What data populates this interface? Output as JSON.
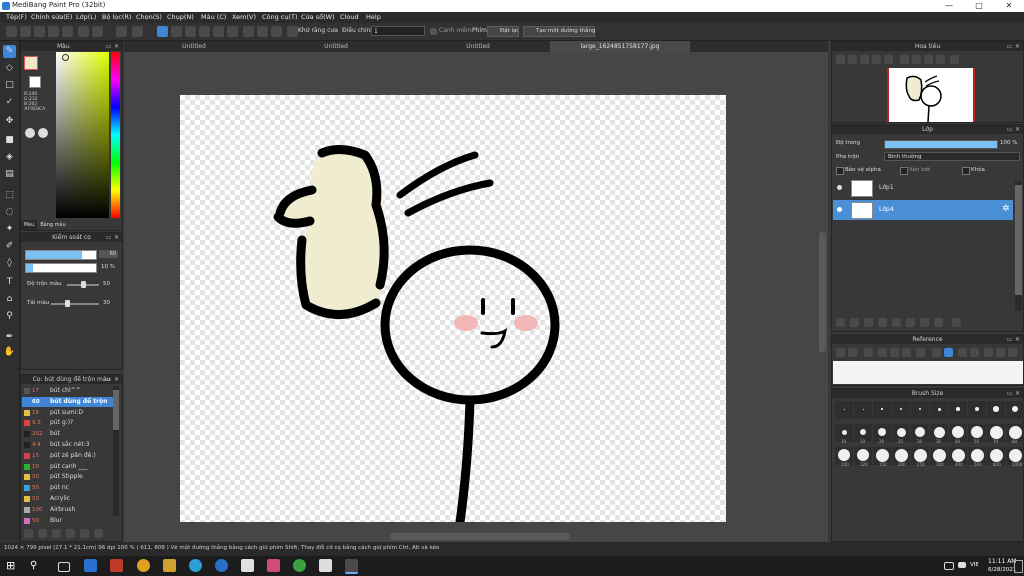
{
  "window": {
    "title": "MediBang Paint Pro (32bit)",
    "minimize": "—",
    "maximize": "□",
    "close": "✕"
  },
  "menu": [
    "Tệp(F)",
    "Chỉnh sửa(E)",
    "Lớp(L)",
    "Bộ lọc(R)",
    "Chọn(S)",
    "Chụp(N)",
    "Màu (C)",
    "Xem(V)",
    "Công cụ(T)",
    "Cửa sổ(W)",
    "Cloud",
    "Help"
  ],
  "toolbar": {
    "antialias_label": "Khử răng cưa",
    "correction_label": "Điều chỉnh",
    "correction_value": "1",
    "edge_label": "Cạnh mềm",
    "pen_label": "Phím",
    "clear_label": "Đặt lại",
    "straight_line_label": "Tạo một đường thẳng"
  },
  "tabs": [
    "Untitled",
    "Untitled",
    "Untitled",
    "large_1624851758177.jpg"
  ],
  "color_panel": {
    "title": "Màu",
    "rgb": [
      "R:240",
      "G:232",
      "B:202"
    ],
    "hex": "#F0E8CA",
    "tab_color": "Màu",
    "tab_palette": "Bảng màu"
  },
  "brush_ctrl": {
    "title": "Kiểm soát cọ",
    "width_value": "60",
    "opacity_value": "10 %",
    "mix_label": "Độ trộn màu",
    "mix_value": "50",
    "dilution_label": "Tải màu",
    "dilution_value": "30"
  },
  "brush_panel": {
    "title": "Cọ: bút dùng để trộn màu",
    "items": [
      {
        "size": "17",
        "name": "bút chì^^",
        "color": "#555555"
      },
      {
        "size": "60",
        "name": "bút dùng để trộn",
        "color": "#3f86d6"
      },
      {
        "size": "16",
        "name": "pút sumi:D",
        "color": "#e0c040"
      },
      {
        "size": "9.3",
        "name": "pút g:)?",
        "color": "#e04040"
      },
      {
        "size": "202",
        "name": "bút",
        "color": "#222222"
      },
      {
        "size": "4.4",
        "name": "bút sắc nét:3",
        "color": "#222222"
      },
      {
        "size": "15",
        "name": "pút zê pân đê:)",
        "color": "#e04040"
      },
      {
        "size": "10",
        "name": "pút cạnh ___",
        "color": "#30b030"
      },
      {
        "size": "50",
        "name": "pút Stipple",
        "color": "#e0c040"
      },
      {
        "size": "50",
        "name": "pút nc",
        "color": "#3fa0d6"
      },
      {
        "size": "50",
        "name": "Acrylic",
        "color": "#e0c040"
      },
      {
        "size": "100",
        "name": "Airbrush",
        "color": "#aaaaaa"
      },
      {
        "size": "50",
        "name": "Blur",
        "color": "#d070c0"
      }
    ]
  },
  "navigator": {
    "title": "Hoa tiêu"
  },
  "layers": {
    "title": "Lớp",
    "opacity_label": "Độ trong",
    "opacity_value": "100 %",
    "blend_label": "Pha trộn",
    "blend_value": "Bình thường",
    "protect_label": "Bảo vệ alpha",
    "clip_label": "Xén bớt",
    "lock_label": "Khóa",
    "items": [
      {
        "name": "Lớp1",
        "selected": false
      },
      {
        "name": "Lớp4",
        "selected": true
      }
    ]
  },
  "reference": {
    "title": "Reference"
  },
  "brush_size": {
    "title": "Brush Size",
    "labels_row2": [
      "10",
      "10",
      "20",
      "25",
      "30",
      "35",
      "40",
      "50",
      "70",
      "80"
    ],
    "labels_row3": [
      "100",
      "120",
      "150",
      "200",
      "250",
      "300",
      "400",
      "500",
      "800",
      "1000"
    ]
  },
  "status": {
    "text": "1024 × 799 pixel  (27.1 * 21.1cm)  96 dpi  100 %  ( 611, 808 )  Vẽ một đường thẳng bằng cách giữ phím Shift, Thay đổi cỡ cọ bằng cách giữ phím Ctrl, Alt và kéo"
  },
  "taskbar": {
    "time": "11:11 AM",
    "date": "6/28/2021",
    "lang": "VIE"
  },
  "colors": {
    "accent": "#3f86d6",
    "fg_color": "#f0e8ca"
  }
}
